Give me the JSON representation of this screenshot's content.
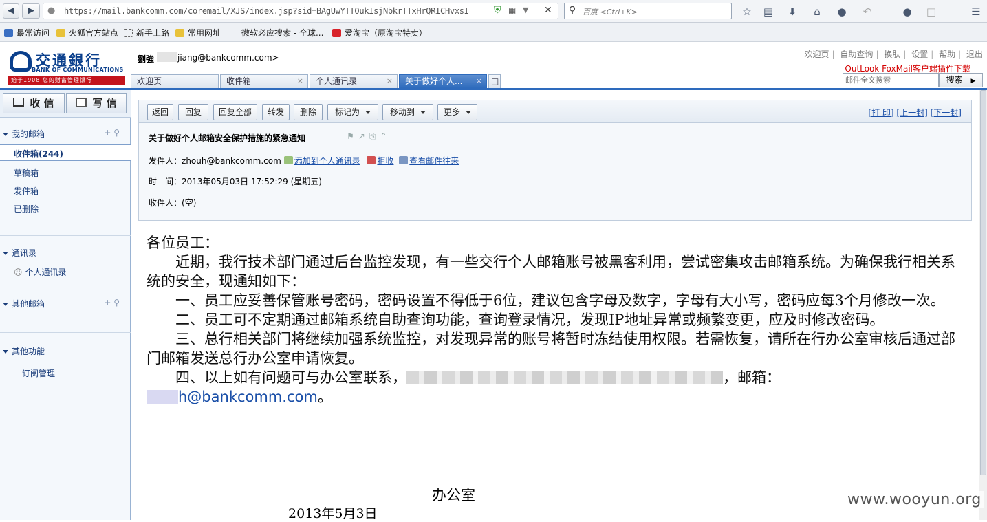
{
  "browser": {
    "url": "https://mail.bankcomm.com/coremail/XJS/index.jsp?sid=BAgUwYTTOukIsjNbkrTTxHrQRICHvxsI",
    "search_placeholder": "百度 <Ctrl+K>",
    "bookmarks": [
      "最常访问",
      "火狐官方站点",
      "新手上路",
      "常用网址",
      "微软必应搜索 - 全球...",
      "爱淘宝（原淘宝特卖）"
    ]
  },
  "header": {
    "logo_cn": "交通銀行",
    "logo_en": "BANK OF COMMUNICATIONS",
    "logo_slogan": "始于1908 您的财富管理银行",
    "user_name": "劉強",
    "user_email": "jiang@bankcomm.com>",
    "top_links": [
      "欢迎页",
      "自助查询",
      "换肤",
      "设置",
      "帮助",
      "退出"
    ],
    "plugin_link": "OutLook FoxMail客户端插件下载",
    "fulltext_placeholder": "邮件全文搜索",
    "fulltext_button": "搜索"
  },
  "tabs": [
    {
      "label": "欢迎页"
    },
    {
      "label": "收件箱"
    },
    {
      "label": "个人通讯录"
    },
    {
      "label": "关于做好个人..."
    }
  ],
  "sidebar": {
    "receive_label": "收 信",
    "compose_label": "写 信",
    "my_mailbox": "我的邮箱",
    "inbox": "收件箱(244)",
    "drafts": "草稿箱",
    "sent": "发件箱",
    "deleted": "已删除",
    "contacts_section": "通讯录",
    "personal_contacts": "个人通讯录",
    "other_mailbox": "其他邮箱",
    "other_functions": "其他功能",
    "subscriptions": "订阅管理"
  },
  "toolbar": {
    "back": "返回",
    "reply": "回复",
    "reply_all": "回复全部",
    "forward": "转发",
    "delete": "删除",
    "mark_as": "标记为",
    "move_to": "移动到",
    "more": "更多",
    "print": "[打 印]",
    "prev": "[上一封]",
    "next": "[下一封]"
  },
  "message": {
    "subject": "关于做好个人邮箱安全保护措施的紧急通知",
    "from_label": "发件人：",
    "from": "zhouh@bankcomm.com",
    "add_contact": "添加到个人通讯录",
    "reject": "拒收",
    "view_history": "查看邮件往来",
    "time_label": "时　间：",
    "time": "2013年05月03日 17:52:29 (星期五)",
    "to_label": "收件人：",
    "to": "(空)",
    "greeting": "各位员工：",
    "p1": "近期，我行技术部门通过后台监控发现，有一些交行个人邮箱账号被黑客利用，尝试密集攻击邮箱系统。为确保我行相关系统的安全，现通知如下：",
    "p2": "一、员工应妥善保管账号密码，密码设置不得低于6位，建议包含字母及数字，字母有大小写，密码应每3个月修改一次。",
    "p3": "二、员工可不定期通过邮箱系统自助查询功能，查询登录情况，发现IP地址异常或频繁变更，应及时修改密码。",
    "p4": "三、总行相关部门将继续加强系统监控，对发现异常的账号将暂时冻结使用权限。若需恢复，请所在行办公室审核后通过部门邮箱发送总行办公室申请恢复。",
    "p5_start": "四、以上如有问题可与办公室联系，",
    "p5_end": "，邮箱：",
    "email_suffix": "h@bankcomm.com",
    "email_end": "。",
    "sign_office": "办公室",
    "sign_date": "2013年5月3日"
  },
  "watermark": "www.wooyun.org"
}
